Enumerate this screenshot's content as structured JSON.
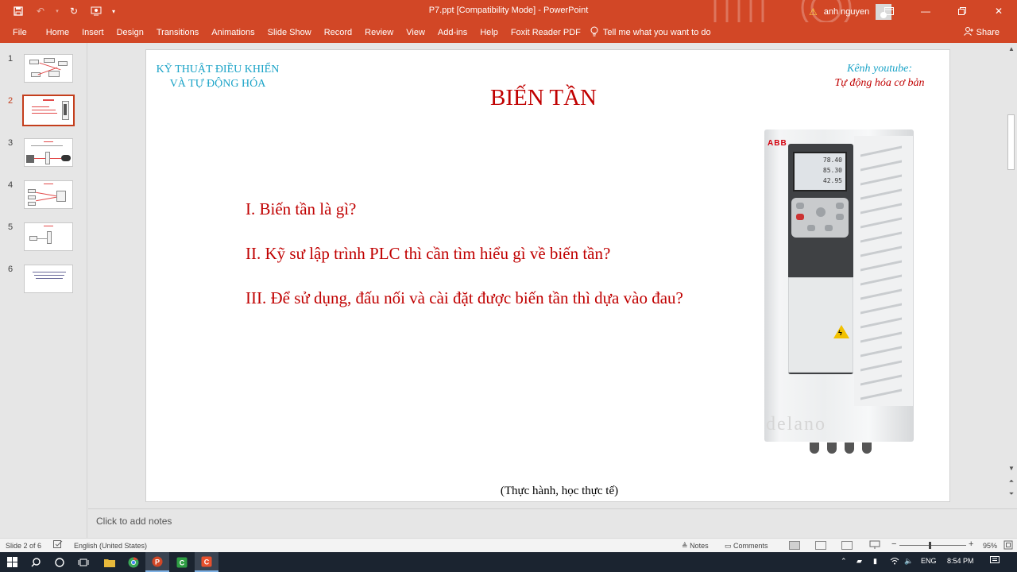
{
  "window": {
    "title": "P7.ppt [Compatibility Mode]  -  PowerPoint",
    "user_name": "anh nguyen",
    "controls": [
      "minimize",
      "restore",
      "close"
    ]
  },
  "qat": {
    "icons": [
      "save-icon",
      "undo-icon",
      "redo-icon",
      "repeat-icon",
      "touch-mode-icon",
      "customize-icon"
    ]
  },
  "ribbon": {
    "tabs": [
      "File",
      "Home",
      "Insert",
      "Design",
      "Transitions",
      "Animations",
      "Slide Show",
      "Record",
      "Review",
      "View",
      "Add-ins",
      "Help",
      "Foxit Reader PDF"
    ],
    "tell_me": "Tell me what you want to do",
    "share": "Share"
  },
  "thumbnails": {
    "numbers": [
      "1",
      "2",
      "3",
      "4",
      "5",
      "6"
    ],
    "selected_index": 2
  },
  "slide": {
    "org_line1": "KỸ THUẬT ĐIỀU KHIỂN",
    "org_line2": "VÀ TỰ ĐỘNG HÓA",
    "yt_line1": "Kênh youtube:",
    "yt_line2": "Tự động hóa cơ bản",
    "title": "BIẾN TẦN",
    "bullets": [
      "I. Biến tần là gì?",
      "II. Kỹ sư lập trình PLC thì cần tìm hiểu gì về biến tần?",
      "III. Để sử dụng, đấu nối và cài đặt được biến tần thì dựa vào đau?"
    ],
    "caption": "(Thực hành, học thực tế)",
    "drive_brand": "ABB",
    "drive_readings": [
      "78.40",
      "85.30",
      "42.95"
    ],
    "drive_watermark": "delano"
  },
  "notes": {
    "placeholder": "Click to add notes"
  },
  "status": {
    "slide_counter": "Slide 2 of 6",
    "language": "English (United States)",
    "notes_btn": "Notes",
    "comments_btn": "Comments",
    "zoom": "95%"
  },
  "taskbar": {
    "apps": [
      "start-icon",
      "search-icon",
      "cortana-icon",
      "task-view-icon",
      "file-explorer-icon",
      "chrome-icon",
      "powerpoint-icon",
      "camtasia-icon",
      "recorder-icon"
    ],
    "language": "ENG",
    "time": "8:54 PM"
  },
  "colors": {
    "accent": "#d24726",
    "title_red": "#c00000",
    "teal": "#1aa3c7"
  }
}
